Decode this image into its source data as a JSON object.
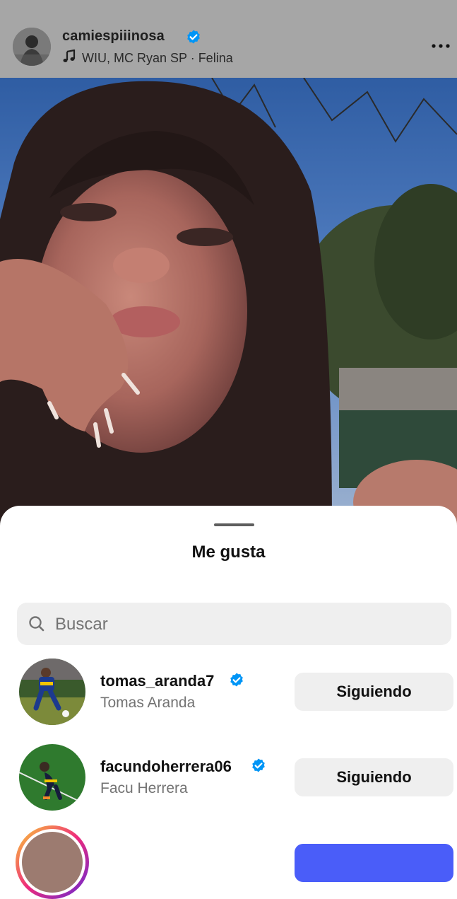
{
  "post": {
    "username": "camiespiiinosa",
    "music": "WIU, MC Ryan SP · Felina"
  },
  "likes_sheet": {
    "title": "Me gusta",
    "search_placeholder": "Buscar",
    "users": [
      {
        "username": "tomas_aranda7",
        "full_name": "Tomas Aranda",
        "verified": true,
        "button_label": "Siguiendo"
      },
      {
        "username": "facundoherrera06",
        "full_name": "Facu Herrera",
        "verified": true,
        "button_label": "Siguiendo"
      }
    ]
  },
  "colors": {
    "verified_badge": "#0095f6",
    "follow_primary": "#4a5df9",
    "secondary_button": "#efefef",
    "header_bg": "#a6a6a6"
  }
}
